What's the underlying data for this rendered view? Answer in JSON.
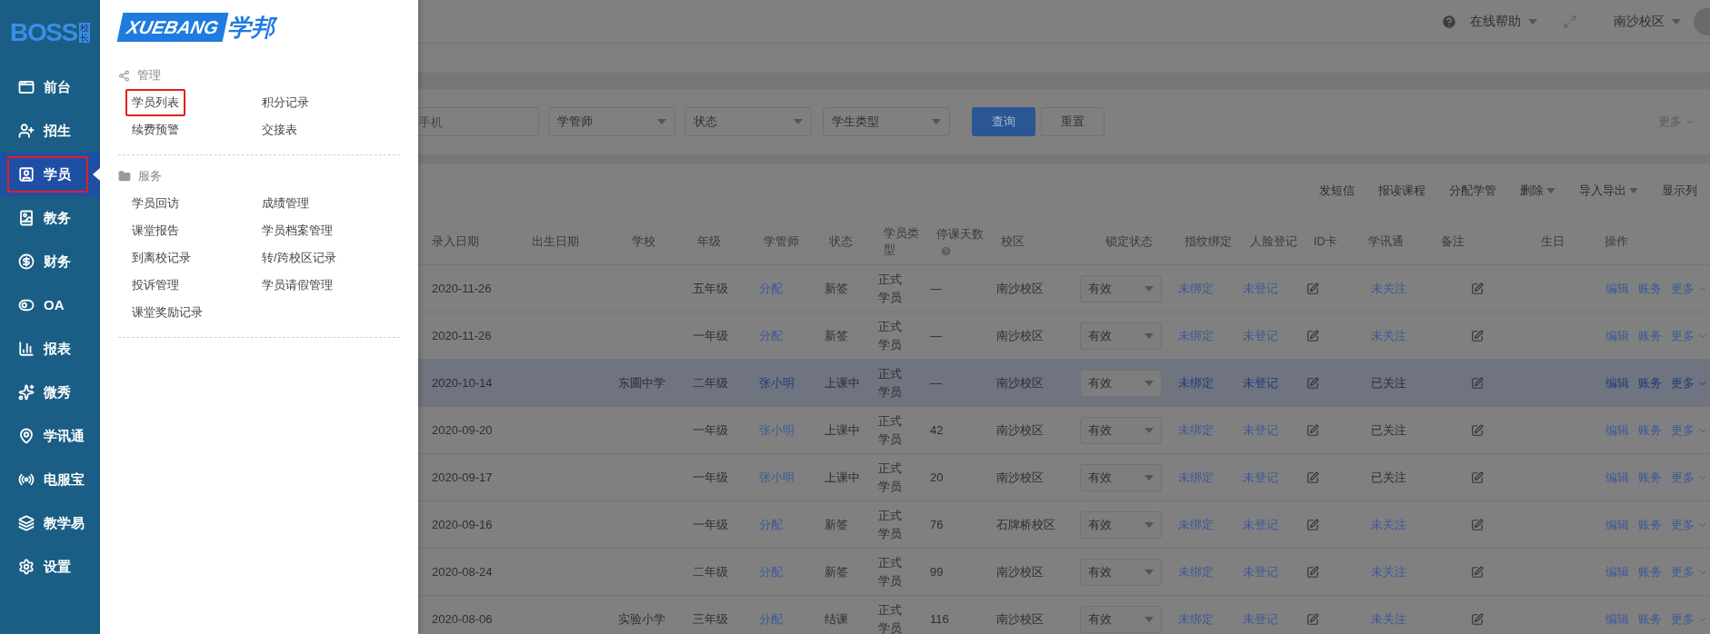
{
  "sidebar": {
    "logo": {
      "text": "BOSS",
      "badge": "校长"
    },
    "items": [
      {
        "label": "前台",
        "selected": false,
        "annotated": false
      },
      {
        "label": "招生",
        "selected": false,
        "annotated": false
      },
      {
        "label": "学员",
        "selected": true,
        "annotated": true
      },
      {
        "label": "教务",
        "selected": false,
        "annotated": false
      },
      {
        "label": "财务",
        "selected": false,
        "annotated": false
      },
      {
        "label": "OA",
        "selected": false,
        "annotated": false
      },
      {
        "label": "报表",
        "selected": false,
        "annotated": false
      },
      {
        "label": "微秀",
        "selected": false,
        "annotated": false
      },
      {
        "label": "学讯通",
        "selected": false,
        "annotated": false
      },
      {
        "label": "电服宝",
        "selected": false,
        "annotated": false
      },
      {
        "label": "教学易",
        "selected": false,
        "annotated": false
      },
      {
        "label": "设置",
        "selected": false,
        "annotated": false
      }
    ]
  },
  "menu_panel": {
    "logo": {
      "latin": "XUEBANG",
      "cjk": "学邦"
    },
    "sections": [
      {
        "title": "管理",
        "items": [
          {
            "label": "学员列表",
            "annotated": true
          },
          {
            "label": "积分记录",
            "annotated": false
          },
          {
            "label": "续费预警",
            "annotated": false
          },
          {
            "label": "交接表",
            "annotated": false
          }
        ]
      },
      {
        "title": "服务",
        "items": [
          {
            "label": "学员回访",
            "annotated": false
          },
          {
            "label": "成绩管理",
            "annotated": false
          },
          {
            "label": "课堂报告",
            "annotated": false
          },
          {
            "label": "学员档案管理",
            "annotated": false
          },
          {
            "label": "到离校记录",
            "annotated": false
          },
          {
            "label": "转/跨校区记录",
            "annotated": false
          },
          {
            "label": "投诉管理",
            "annotated": false
          },
          {
            "label": "学员请假管理",
            "annotated": false
          },
          {
            "label": "课堂奖励记录",
            "annotated": false
          }
        ]
      }
    ]
  },
  "top_bar": {
    "help": "在线帮助",
    "campus": "南沙校区"
  },
  "filters": {
    "phone": {
      "placeholder": "手机"
    },
    "selects": [
      "学管师",
      "状态",
      "学生类型"
    ],
    "search_button": "查询",
    "reset_button": "重置",
    "more": "更多"
  },
  "toolbar": [
    {
      "label": "发短信",
      "dropdown": false
    },
    {
      "label": "报读课程",
      "dropdown": false
    },
    {
      "label": "分配学管",
      "dropdown": false
    },
    {
      "label": "删除",
      "dropdown": true
    },
    {
      "label": "导入导出",
      "dropdown": true
    },
    {
      "label": "显示列",
      "dropdown": false
    }
  ],
  "table": {
    "columns": [
      "录入日期",
      "出生日期",
      "学校",
      "年级",
      "学管师",
      "状态",
      "学员类型",
      "停课天数",
      "校区",
      "锁定状态",
      "指纹绑定",
      "人脸登记",
      "ID卡",
      "学讯通",
      "备注",
      "生日",
      "操作"
    ],
    "rows": [
      {
        "selected": false,
        "date": "2020-11-26",
        "grade": "五年级",
        "manager": "分配",
        "status": "新签",
        "type": "正式学员",
        "stop_days": "—",
        "campus": "南沙校区",
        "lock": "有效",
        "fingerprint": "未绑定",
        "face": "未登记",
        "wechat": "未关注",
        "followed": false,
        "actions": [
          "编辑",
          "账务",
          "更多"
        ]
      },
      {
        "selected": false,
        "date": "2020-11-26",
        "grade": "一年级",
        "manager": "分配",
        "status": "新签",
        "type": "正式学员",
        "stop_days": "—",
        "campus": "南沙校区",
        "lock": "有效",
        "fingerprint": "未绑定",
        "face": "未登记",
        "wechat": "未关注",
        "followed": false,
        "actions": [
          "编辑",
          "账务",
          "更多"
        ]
      },
      {
        "selected": true,
        "date": "2020-10-14",
        "school": "东圃中学",
        "grade": "二年级",
        "manager": "张小明",
        "status": "上课中",
        "type": "正式学员",
        "stop_days": "—",
        "campus": "南沙校区",
        "lock": "有效",
        "fingerprint": "未绑定",
        "face": "未登记",
        "wechat": "已关注",
        "followed": true,
        "actions": [
          "编辑",
          "账务",
          "更多"
        ]
      },
      {
        "selected": false,
        "date": "2020-09-20",
        "grade": "一年级",
        "manager": "张小明",
        "status": "上课中",
        "type": "正式学员",
        "stop_days": "42",
        "campus": "南沙校区",
        "lock": "有效",
        "fingerprint": "未绑定",
        "face": "未登记",
        "wechat": "已关注",
        "followed": true,
        "actions": [
          "编辑",
          "账务",
          "更多"
        ]
      },
      {
        "selected": false,
        "date": "2020-09-17",
        "grade": "一年级",
        "manager": "张小明",
        "status": "上课中",
        "type": "正式学员",
        "stop_days": "20",
        "campus": "南沙校区",
        "lock": "有效",
        "fingerprint": "未绑定",
        "face": "未登记",
        "wechat": "已关注",
        "followed": true,
        "actions": [
          "编辑",
          "账务",
          "更多"
        ]
      },
      {
        "selected": false,
        "date": "2020-09-16",
        "grade": "一年级",
        "manager": "分配",
        "status": "新签",
        "type": "正式学员",
        "stop_days": "76",
        "campus": "石牌桥校区",
        "lock": "有效",
        "fingerprint": "未绑定",
        "face": "未登记",
        "wechat": "未关注",
        "followed": false,
        "actions": [
          "编辑",
          "账务",
          "更多"
        ]
      },
      {
        "selected": false,
        "date": "2020-08-24",
        "grade": "二年级",
        "manager": "分配",
        "status": "新签",
        "type": "正式学员",
        "stop_days": "99",
        "campus": "南沙校区",
        "lock": "有效",
        "fingerprint": "未绑定",
        "face": "未登记",
        "wechat": "未关注",
        "followed": false,
        "actions": [
          "编辑",
          "账务",
          "更多"
        ]
      },
      {
        "selected": false,
        "date": "2020-08-06",
        "school": "实验小学",
        "grade": "三年级",
        "manager": "分配",
        "status": "结课",
        "type": "正式学员",
        "stop_days": "116",
        "campus": "南沙校区",
        "lock": "有效",
        "fingerprint": "未绑定",
        "face": "未登记",
        "wechat": "未关注",
        "followed": false,
        "actions": [
          "编辑",
          "账务",
          "更多"
        ]
      }
    ]
  }
}
